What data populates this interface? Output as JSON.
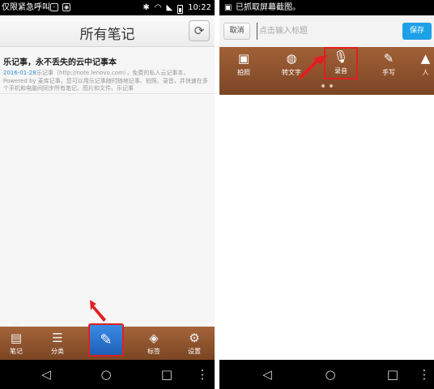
{
  "left": {
    "statusbar": {
      "carrier": "仅限紧急呼叫",
      "time": "10:22"
    },
    "header": {
      "title": "所有笔记"
    },
    "notes": [
      {
        "title": "乐记事，永不丢失的云中记事本",
        "date": "2016-01-28",
        "body": "乐记事（http://note.lenovo.com），免费的私人云记事本，Powered by 麦库记事，您可以用乐记事随时随地记事、拍照、录音，并快速在多个手机和电脑间同步所有笔记、图片和文件、乐记事"
      }
    ],
    "tabs": {
      "notes": "笔记",
      "categories": "分类",
      "tags": "标签",
      "settings": "设置"
    }
  },
  "right": {
    "statusbar": {
      "notice": "已抓取屏幕截图。"
    },
    "editor": {
      "cancel_label": "取消",
      "title_placeholder": "点击输入标题",
      "save_label": "保存"
    },
    "toolbar": {
      "photo": "拍照",
      "speech_to_text": "转文字",
      "record": "录音",
      "handwrite": "手写",
      "more": "人"
    }
  },
  "colors": {
    "wood": "#8a5230",
    "accent_blue": "#1ca0e8",
    "highlight_red": "#e02020",
    "date_blue": "#2a8fd0"
  },
  "icons": [
    "sync-icon",
    "notes-icon",
    "categories-icon",
    "compose-icon",
    "tag-icon",
    "gear-icon",
    "camera-icon",
    "microphone-icon",
    "pen-icon"
  ]
}
